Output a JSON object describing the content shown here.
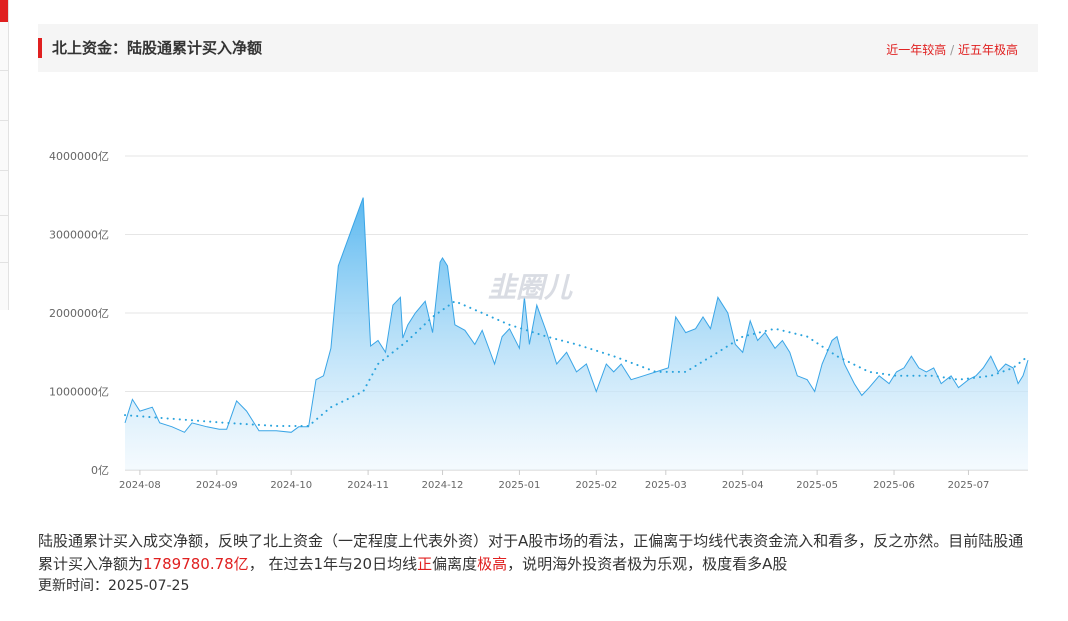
{
  "header": {
    "title": "北上资金：陆股通累计买入净额",
    "link_1y": "近一年较高",
    "separator": " / ",
    "link_5y": "近五年极高"
  },
  "watermark": "韭圈儿",
  "description": {
    "part1": "陆股通累计买入成交净额，反映了北上资金（一定程度上代表外资）对于A股市场的看法，正偏离于均线代表资金流入和看多，反之亦然。目前陆股通累计买入净额为",
    "value": "1789780.78亿",
    "part2": "，  在过去1年与20日均线",
    "direction": "正",
    "part3": "偏离度",
    "level": "极高",
    "part4": "，说明海外投资者极为乐观，极度看多A股"
  },
  "update_time": "更新时间：2025-07-25",
  "colors": {
    "accent_red": "#e02020",
    "series_line": "#3aa5e6",
    "fill_top": "#5ab8f0",
    "ma_dots": "#29a3dd"
  },
  "chart_data": {
    "type": "area",
    "title": "",
    "xlabel": "",
    "ylabel": "",
    "ylim": [
      0,
      4000000
    ],
    "y_ticks": [
      0,
      1000000,
      2000000,
      3000000,
      4000000
    ],
    "y_tick_labels": [
      "0亿",
      "1000000亿",
      "2000000亿",
      "3000000亿",
      "4000000亿"
    ],
    "x_tick_labels": [
      "2024-08",
      "2024-09",
      "2024-10",
      "2024-11",
      "2024-12",
      "2025-01",
      "2025-02",
      "2025-03",
      "2025-04",
      "2025-05",
      "2025-06",
      "2025-07"
    ],
    "x_range": [
      "2024-07-26",
      "2025-07-25"
    ],
    "grid": "horizontal",
    "series": [
      {
        "values": [
          [
            "2024-07-26",
            600000
          ],
          [
            "2024-07-29",
            900000
          ],
          [
            "2024-08-01",
            750000
          ],
          [
            "2024-08-06",
            800000
          ],
          [
            "2024-08-09",
            600000
          ],
          [
            "2024-08-14",
            550000
          ],
          [
            "2024-08-19",
            480000
          ],
          [
            "2024-08-22",
            600000
          ],
          [
            "2024-08-28",
            550000
          ],
          [
            "2024-09-02",
            520000
          ],
          [
            "2024-09-05",
            520000
          ],
          [
            "2024-09-09",
            880000
          ],
          [
            "2024-09-13",
            750000
          ],
          [
            "2024-09-18",
            500000
          ],
          [
            "2024-09-25",
            500000
          ],
          [
            "2024-10-01",
            480000
          ],
          [
            "2024-10-04",
            550000
          ],
          [
            "2024-10-08",
            550000
          ],
          [
            "2024-10-11",
            1150000
          ],
          [
            "2024-10-14",
            1200000
          ],
          [
            "2024-10-17",
            1550000
          ],
          [
            "2024-10-20",
            2600000
          ],
          [
            "2024-10-30",
            3470000
          ],
          [
            "2024-11-02",
            1580000
          ],
          [
            "2024-11-05",
            1650000
          ],
          [
            "2024-11-08",
            1500000
          ],
          [
            "2024-11-11",
            2100000
          ],
          [
            "2024-11-14",
            2200000
          ],
          [
            "2024-11-15",
            1680000
          ],
          [
            "2024-11-17",
            1850000
          ],
          [
            "2024-11-20",
            2000000
          ],
          [
            "2024-11-24",
            2150000
          ],
          [
            "2024-11-27",
            1750000
          ],
          [
            "2024-11-30",
            2650000
          ],
          [
            "2024-12-01",
            2700000
          ],
          [
            "2024-12-03",
            2600000
          ],
          [
            "2024-12-06",
            1850000
          ],
          [
            "2024-12-10",
            1780000
          ],
          [
            "2024-12-14",
            1600000
          ],
          [
            "2024-12-17",
            1780000
          ],
          [
            "2024-12-22",
            1350000
          ],
          [
            "2024-12-25",
            1700000
          ],
          [
            "2024-12-28",
            1800000
          ],
          [
            "2025-01-01",
            1550000
          ],
          [
            "2025-01-03",
            2200000
          ],
          [
            "2025-01-05",
            1600000
          ],
          [
            "2025-01-08",
            2100000
          ],
          [
            "2025-01-12",
            1750000
          ],
          [
            "2025-01-16",
            1350000
          ],
          [
            "2025-01-20",
            1500000
          ],
          [
            "2025-01-24",
            1250000
          ],
          [
            "2025-01-28",
            1350000
          ],
          [
            "2025-02-01",
            1000000
          ],
          [
            "2025-02-05",
            1350000
          ],
          [
            "2025-02-08",
            1250000
          ],
          [
            "2025-02-11",
            1350000
          ],
          [
            "2025-02-15",
            1150000
          ],
          [
            "2025-02-20",
            1200000
          ],
          [
            "2025-02-25",
            1250000
          ],
          [
            "2025-03-02",
            1300000
          ],
          [
            "2025-03-05",
            1950000
          ],
          [
            "2025-03-09",
            1750000
          ],
          [
            "2025-03-13",
            1800000
          ],
          [
            "2025-03-16",
            1950000
          ],
          [
            "2025-03-19",
            1800000
          ],
          [
            "2025-03-22",
            2200000
          ],
          [
            "2025-03-26",
            2000000
          ],
          [
            "2025-03-29",
            1600000
          ],
          [
            "2025-04-01",
            1500000
          ],
          [
            "2025-04-04",
            1900000
          ],
          [
            "2025-04-07",
            1650000
          ],
          [
            "2025-04-10",
            1750000
          ],
          [
            "2025-04-14",
            1550000
          ],
          [
            "2025-04-17",
            1650000
          ],
          [
            "2025-04-20",
            1500000
          ],
          [
            "2025-04-23",
            1200000
          ],
          [
            "2025-04-27",
            1150000
          ],
          [
            "2025-04-30",
            1000000
          ],
          [
            "2025-05-03",
            1350000
          ],
          [
            "2025-05-07",
            1650000
          ],
          [
            "2025-05-09",
            1700000
          ],
          [
            "2025-05-12",
            1350000
          ],
          [
            "2025-05-16",
            1100000
          ],
          [
            "2025-05-19",
            950000
          ],
          [
            "2025-05-22",
            1050000
          ],
          [
            "2025-05-26",
            1200000
          ],
          [
            "2025-05-30",
            1100000
          ],
          [
            "2025-06-02",
            1250000
          ],
          [
            "2025-06-05",
            1300000
          ],
          [
            "2025-06-08",
            1450000
          ],
          [
            "2025-06-11",
            1300000
          ],
          [
            "2025-06-14",
            1250000
          ],
          [
            "2025-06-17",
            1300000
          ],
          [
            "2025-06-20",
            1100000
          ],
          [
            "2025-06-24",
            1200000
          ],
          [
            "2025-06-27",
            1050000
          ],
          [
            "2025-07-01",
            1150000
          ],
          [
            "2025-07-04",
            1200000
          ],
          [
            "2025-07-07",
            1300000
          ],
          [
            "2025-07-10",
            1450000
          ],
          [
            "2025-07-13",
            1250000
          ],
          [
            "2025-07-16",
            1350000
          ],
          [
            "2025-07-19",
            1300000
          ],
          [
            "2025-07-21",
            1100000
          ],
          [
            "2025-07-23",
            1200000
          ],
          [
            "2025-07-25",
            1400000
          ]
        ]
      },
      {
        "style": "dotted",
        "values": [
          [
            "2024-07-26",
            700000
          ],
          [
            "2024-08-15",
            650000
          ],
          [
            "2024-09-05",
            600000
          ],
          [
            "2024-09-25",
            560000
          ],
          [
            "2024-10-08",
            560000
          ],
          [
            "2024-10-17",
            800000
          ],
          [
            "2024-10-30",
            1000000
          ],
          [
            "2024-11-05",
            1350000
          ],
          [
            "2024-11-17",
            1650000
          ],
          [
            "2024-11-27",
            1950000
          ],
          [
            "2024-12-06",
            2150000
          ],
          [
            "2024-12-17",
            2000000
          ],
          [
            "2024-12-28",
            1850000
          ],
          [
            "2025-01-12",
            1700000
          ],
          [
            "2025-01-24",
            1600000
          ],
          [
            "2025-02-08",
            1450000
          ],
          [
            "2025-02-25",
            1250000
          ],
          [
            "2025-03-09",
            1250000
          ],
          [
            "2025-03-22",
            1500000
          ],
          [
            "2025-04-01",
            1700000
          ],
          [
            "2025-04-14",
            1800000
          ],
          [
            "2025-04-27",
            1700000
          ],
          [
            "2025-05-09",
            1450000
          ],
          [
            "2025-05-22",
            1250000
          ],
          [
            "2025-06-02",
            1200000
          ],
          [
            "2025-06-17",
            1200000
          ],
          [
            "2025-06-27",
            1150000
          ],
          [
            "2025-07-10",
            1200000
          ],
          [
            "2025-07-19",
            1300000
          ],
          [
            "2025-07-25",
            1450000
          ]
        ]
      }
    ]
  }
}
